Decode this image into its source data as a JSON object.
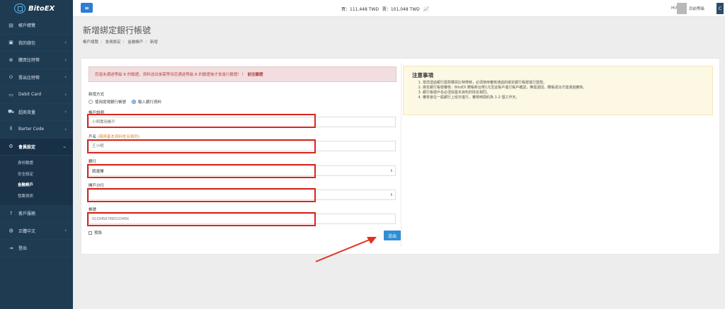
{
  "brand": {
    "name": "BitoEX"
  },
  "topbar": {
    "buy_price": "買：111,448 TWD",
    "sell_price": "賣：101,048 TWD",
    "hi_label": "Hi!",
    "user_label": "目前等級",
    "mode_label": "C"
  },
  "sidebar": {
    "items": [
      {
        "label": "帳戶總覽",
        "icon": "dashboard-icon"
      },
      {
        "label": "我的錢包",
        "icon": "wallet-icon"
      },
      {
        "label": "購買比特幣",
        "icon": "plus-circle-icon"
      },
      {
        "label": "賣出比特幣",
        "icon": "up-circle-icon"
      },
      {
        "label": "Debit Card",
        "icon": "card-icon"
      },
      {
        "label": "超商貨量",
        "icon": "cart-icon"
      },
      {
        "label": "Barter Code",
        "icon": "barcode-icon"
      },
      {
        "label": "會員設定",
        "icon": "gears-icon"
      }
    ],
    "sub_items": [
      "身份驗證",
      "安全設定",
      "金融帳戶",
      "發票資訊"
    ],
    "bottom_items": [
      {
        "label": "客戶服務",
        "icon": "help-icon"
      },
      {
        "label": "正體中文",
        "icon": "globe-icon"
      },
      {
        "label": "登出",
        "icon": "logout-icon"
      }
    ]
  },
  "page": {
    "title": "新增綁定銀行帳號",
    "breadcrumb": [
      "帳戶總覽",
      "會員設定",
      "金融帳戶",
      "新增"
    ]
  },
  "form": {
    "alert": "您還未通過等級 B 的驗證，資料送出後需等待您通過等級 B 的驗證後才會進行驗證！！",
    "alert_link": "前往驗證",
    "method_label": "新增方式",
    "method_options": [
      "使用提現銀行帳號",
      "輸入銀行資料"
    ],
    "nickname_label": "帳戶說明",
    "nickname_placeholder": "小明專用帳戶",
    "owner_label": "戶名",
    "owner_hint": "(需與基本資料姓名相同)",
    "owner_placeholder": "王小明",
    "bank_label": "銀行",
    "bank_value": "請選擇",
    "branch_label": "開戶分行",
    "branch_value": "",
    "account_label": "帳號",
    "account_placeholder": "01234567890123456",
    "default_label": "預設",
    "submit_label": "送出"
  },
  "notes": {
    "title": "注意事項",
    "items": [
      "當您透過銀行匯款購買比特幣時，必須使用審核通過的綁定銀行帳號進行匯款。",
      "綁定銀行帳號審核：BitoEX 轉帳新台幣1元至此帳戶進行帳戶確認，無需退回，轉帳成功才能通過審核。",
      "銀行帳號戶名必須與基本資料的姓名相同。",
      "審核會在一般銀行上班日進行，審核時間約為 1-2 個工作天。"
    ]
  }
}
